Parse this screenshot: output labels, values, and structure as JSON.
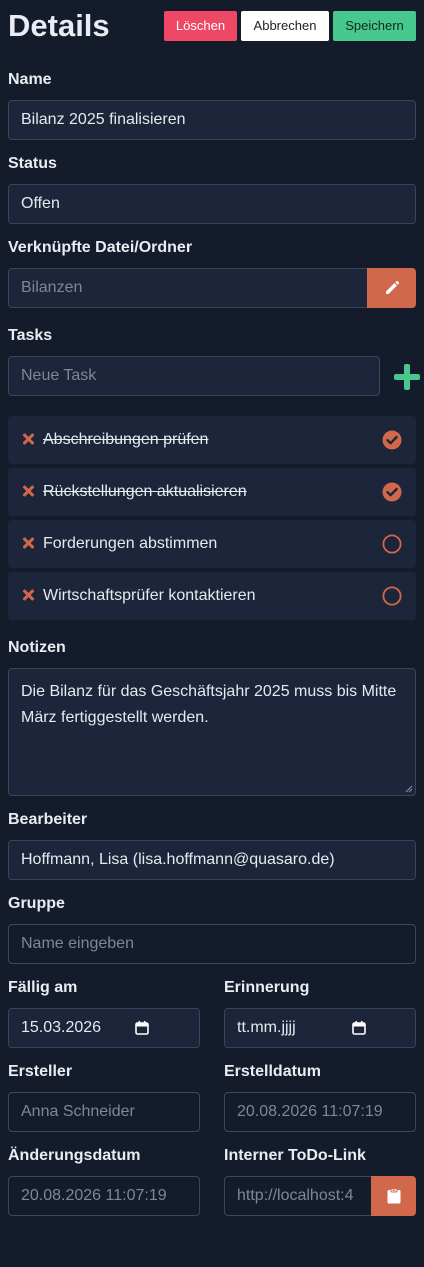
{
  "header": {
    "title": "Details",
    "delete_label": "Löschen",
    "cancel_label": "Abbrechen",
    "save_label": "Speichern"
  },
  "name": {
    "label": "Name",
    "value": "Bilanz 2025 finalisieren"
  },
  "status": {
    "label": "Status",
    "value": "Offen"
  },
  "linked": {
    "label": "Verknüpfte Datei/Ordner",
    "placeholder": "Bilanzen"
  },
  "tasks": {
    "label": "Tasks",
    "placeholder": "Neue Task",
    "items": [
      {
        "text": "Abschreibungen prüfen",
        "done": true
      },
      {
        "text": "Rückstellungen aktualisieren",
        "done": true
      },
      {
        "text": "Forderungen abstimmen",
        "done": false
      },
      {
        "text": "Wirtschaftsprüfer kontaktieren",
        "done": false
      }
    ]
  },
  "notes": {
    "label": "Notizen",
    "value": "Die Bilanz für das Geschäftsjahr 2025 muss bis Mitte März fertiggestellt werden."
  },
  "assignee": {
    "label": "Bearbeiter",
    "value": "Hoffmann, Lisa (lisa.hoffmann@quasaro.de)"
  },
  "group": {
    "label": "Gruppe",
    "placeholder": "Name eingeben"
  },
  "due": {
    "label": "Fällig am",
    "value": "15.03.2026"
  },
  "reminder": {
    "label": "Erinnerung",
    "value": "tt.mm.jjjj"
  },
  "creator": {
    "label": "Ersteller",
    "value": "Anna Schneider"
  },
  "created": {
    "label": "Erstelldatum",
    "value": "20.08.2026 11:07:19"
  },
  "modified": {
    "label": "Änderungsdatum",
    "value": "20.08.2026 11:07:19"
  },
  "link": {
    "label": "Interner ToDo-Link",
    "value": "http://localhost:4"
  },
  "colors": {
    "background": "#141b2a",
    "field": "#1c2539",
    "accent": "#d1684b",
    "success": "#48c78e",
    "danger": "#ef4766"
  }
}
